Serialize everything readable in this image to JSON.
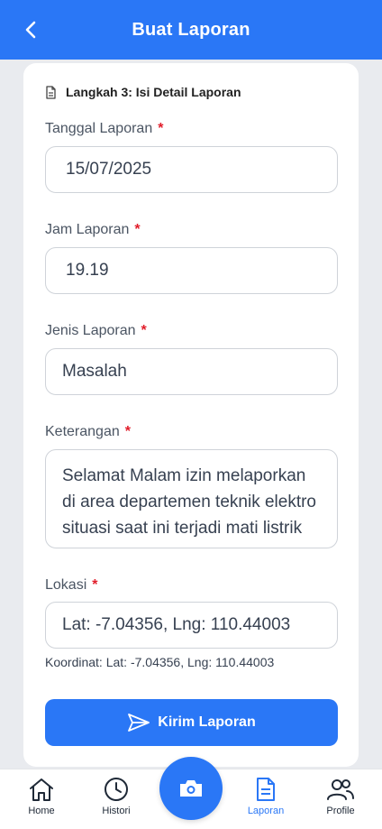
{
  "appbar": {
    "title": "Buat Laporan",
    "back_icon": "chevron-left-icon"
  },
  "step": {
    "label": "Langkah 3: Isi Detail Laporan",
    "icon": "document-icon"
  },
  "fields": {
    "tanggal": {
      "label": "Tanggal Laporan",
      "required": "*",
      "value": "15/07/2025"
    },
    "jam": {
      "label": "Jam Laporan",
      "required": "*",
      "value": "19.19"
    },
    "jenis": {
      "label": "Jenis Laporan",
      "required": "*",
      "value": "Masalah"
    },
    "keterangan": {
      "label": "Keterangan",
      "required": "*",
      "value": "Selamat Malam izin melaporkan di area departemen teknik elektro situasi saat ini terjadi mati listrik"
    },
    "lokasi": {
      "label": "Lokasi",
      "required": "*",
      "value": "Lat: -7.04356, Lng: 110.44003"
    }
  },
  "coordinate_text": "Koordinat: Lat: -7.04356, Lng: 110.44003",
  "submit": {
    "label": "Kirim Laporan",
    "icon": "send-icon"
  },
  "nav": {
    "items": [
      {
        "label": "Home",
        "icon": "home-icon"
      },
      {
        "label": "Histori",
        "icon": "clock-icon"
      },
      {
        "label": "Laporan",
        "icon": "document-icon"
      },
      {
        "label": "Profile",
        "icon": "users-icon"
      }
    ],
    "fab_icon": "camera-icon",
    "active": "Laporan"
  },
  "colors": {
    "primary": "#2a77f6",
    "required": "#e11d2a",
    "background": "#e9ebef"
  }
}
